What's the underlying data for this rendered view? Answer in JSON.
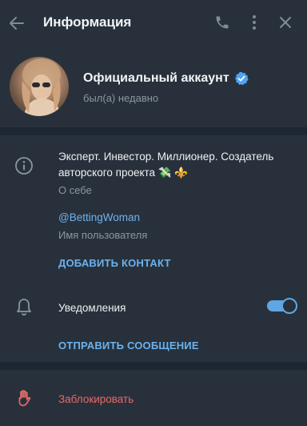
{
  "header": {
    "title": "Информация"
  },
  "profile": {
    "name": "Официальный аккаунт",
    "last_seen": "был(а) недавно"
  },
  "info": {
    "bio": "Эксперт. Инвестор. Миллионер. Создатель авторского проекта 💸 ⚜️",
    "bio_caption": "О себе",
    "username": "@BettingWoman",
    "username_caption": "Имя пользователя",
    "add_contact_label": "ДОБАВИТЬ КОНТАКТ",
    "notifications_label": "Уведомления",
    "notifications_enabled": true,
    "send_message_label": "ОТПРАВИТЬ СООБЩЕНИЕ"
  },
  "block": {
    "label": "Заблокировать"
  },
  "colors": {
    "background": "#1d2733",
    "panel": "#28313b",
    "accent": "#6cb2f0",
    "danger": "#e8686a",
    "muted": "#8a96a3"
  },
  "icons": [
    "back-arrow-icon",
    "phone-icon",
    "more-vertical-icon",
    "close-icon",
    "verified-badge-icon",
    "info-icon",
    "bell-icon",
    "hand-stop-icon"
  ]
}
